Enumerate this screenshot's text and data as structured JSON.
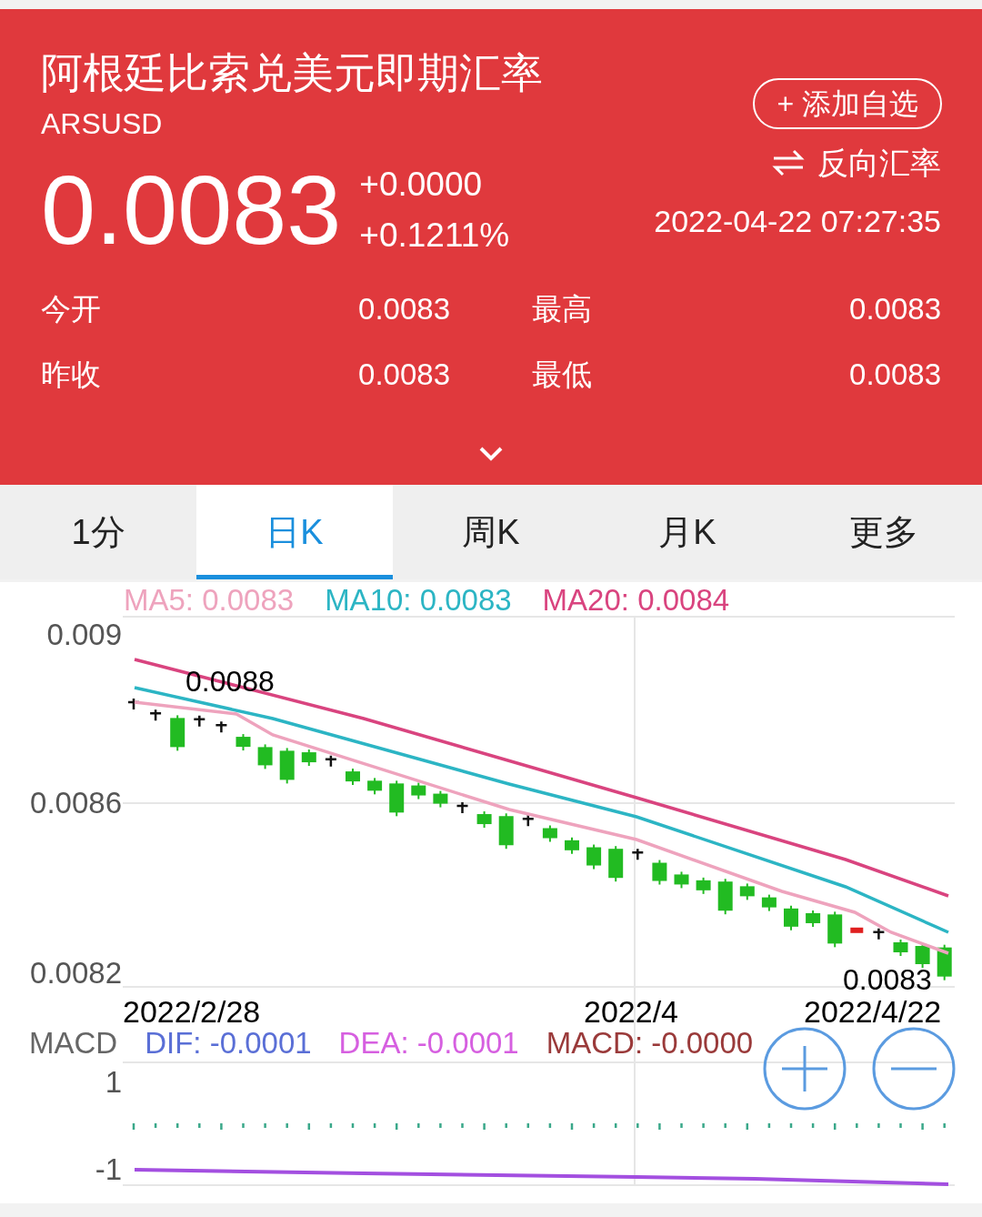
{
  "header": {
    "title": "阿根廷比索兑美元即期汇率",
    "code": "ARSUSD",
    "price": "0.0083",
    "change": "+0.0000",
    "change_pct": "+0.1211%",
    "add_button": "+ 添加自选",
    "reverse_link": "反向汇率",
    "time": "2022-04-22 07:27:35",
    "stats": [
      {
        "label": "今开",
        "value": "0.0083"
      },
      {
        "label": "最高",
        "value": "0.0083"
      },
      {
        "label": "昨收",
        "value": "0.0083"
      },
      {
        "label": "最低",
        "value": "0.0083"
      }
    ]
  },
  "tabs": [
    {
      "label": "1分",
      "selected": false
    },
    {
      "label": "日K",
      "selected": true
    },
    {
      "label": "周K",
      "selected": false
    },
    {
      "label": "月K",
      "selected": false
    },
    {
      "label": "更多",
      "selected": false
    }
  ],
  "chart": {
    "legend": [
      {
        "text": "MA5: 0.0083",
        "color": "#eea3bd"
      },
      {
        "text": "MA10: 0.0083",
        "color": "#2cb5c4"
      },
      {
        "text": "MA20: 0.0084",
        "color": "#d9447f"
      }
    ],
    "y_labels": [
      "0.009",
      "0.0086",
      "0.0082"
    ],
    "high_label": "0.0088",
    "low_label": "0.0083",
    "x_labels": [
      "2022/2/28",
      "2022/4",
      "2022/4/22"
    ]
  },
  "macd": {
    "title": "MACD",
    "legend": [
      {
        "text": "DIF: -0.0001",
        "color": "#5a6fd6"
      },
      {
        "text": "DEA: -0.0001",
        "color": "#d65fe0"
      },
      {
        "text": "MACD: -0.0000",
        "color": "#9a3a3a"
      }
    ],
    "y_labels": [
      "1",
      "-1"
    ]
  }
}
